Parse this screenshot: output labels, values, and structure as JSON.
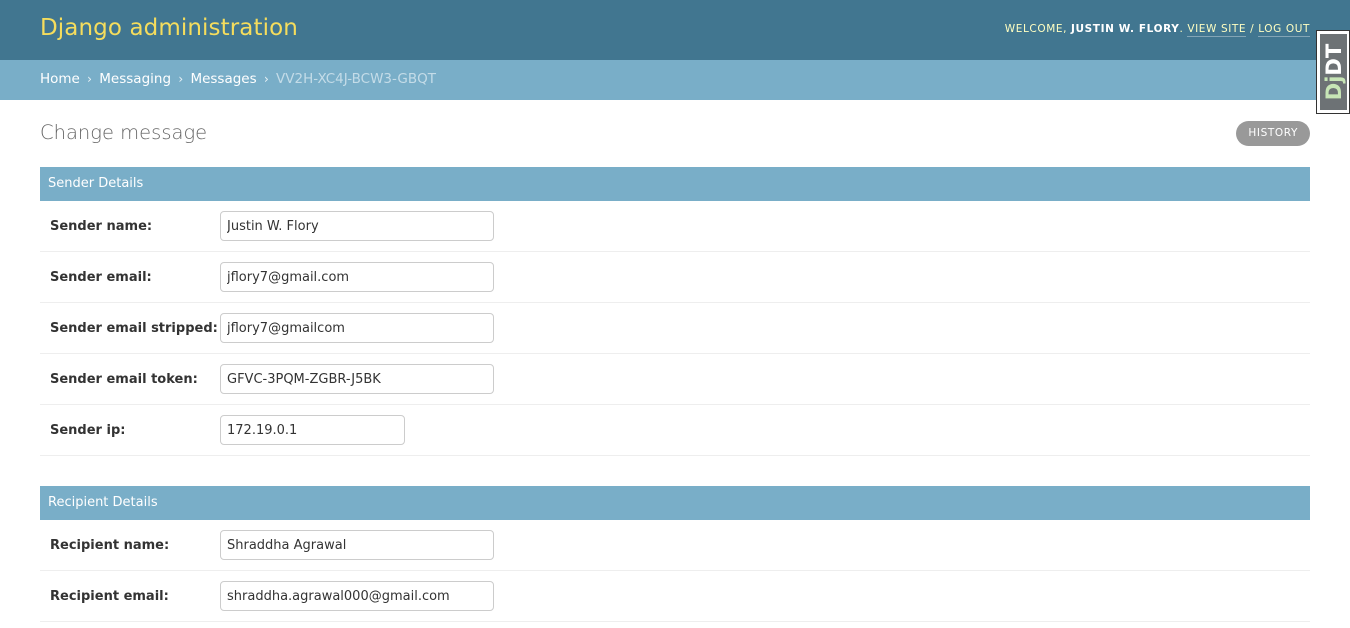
{
  "header": {
    "branding": "Django administration",
    "welcome_label": "Welcome,",
    "username": "Justin W. Flory",
    "view_site": "View site",
    "separator": "/",
    "log_out": "Log out"
  },
  "breadcrumbs": {
    "items": [
      "Home",
      "Messaging",
      "Messages"
    ],
    "separator": "›",
    "current": "VV2H-XC4J-BCW3-GBQT"
  },
  "debug_toolbar": {
    "label_dj": "Dj",
    "label_dt": "DT"
  },
  "page": {
    "title": "Change message",
    "history_button": "History"
  },
  "fieldsets": [
    {
      "title": "Sender Details",
      "fields": [
        {
          "label": "Sender name:",
          "value": "Justin W. Flory"
        },
        {
          "label": "Sender email:",
          "value": "jflory7@gmail.com"
        },
        {
          "label": "Sender email stripped:",
          "value": "jflory7@gmailcom"
        },
        {
          "label": "Sender email token:",
          "value": "GFVC-3PQM-ZGBR-J5BK"
        },
        {
          "label": "Sender ip:",
          "value": "172.19.0.1"
        }
      ]
    },
    {
      "title": "Recipient Details",
      "fields": [
        {
          "label": "Recipient name:",
          "value": "Shraddha Agrawal"
        },
        {
          "label": "Recipient email:",
          "value": "shraddha.agrawal000@gmail.com"
        }
      ]
    }
  ],
  "colors": {
    "header_bg": "#417690",
    "branding": "#f5dd5d",
    "breadcrumb_bg": "#79aec8",
    "module_header_bg": "#79aec8",
    "history_button_bg": "#999999"
  }
}
